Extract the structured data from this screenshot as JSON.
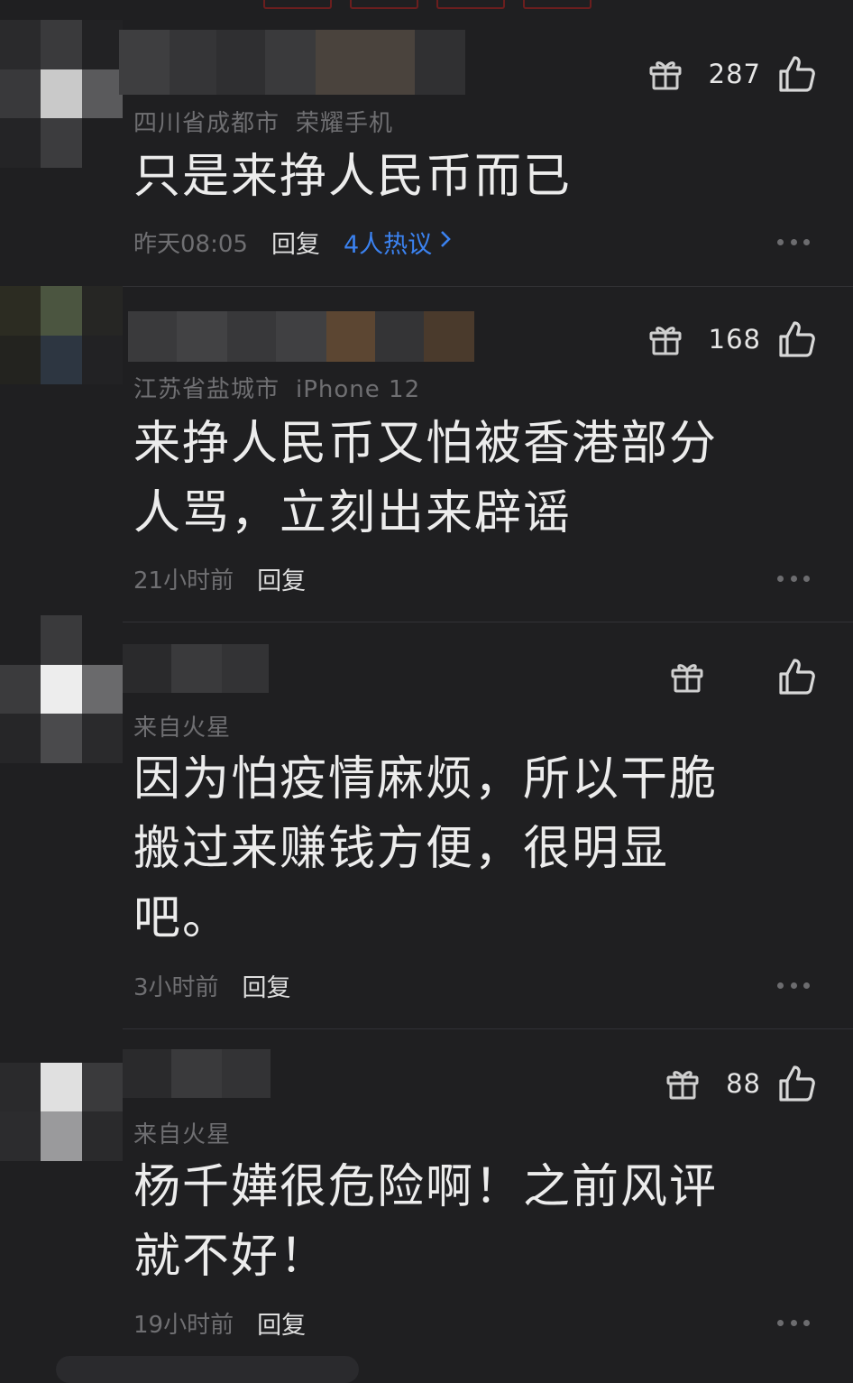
{
  "colors": {
    "background": "#1f1f21",
    "text_primary": "#ececec",
    "text_meta": "#6f6f72",
    "link_blue": "#3b82f0",
    "divider": "#323236"
  },
  "icons": {
    "gift": "gift-icon",
    "like": "thumbs-up-icon",
    "more": "more-dots-icon",
    "chevron": "chevron-right-icon"
  },
  "comments": [
    {
      "meta": [
        "四川省成都市",
        "荣耀手机"
      ],
      "content": [
        "只是来挣人民币而已"
      ],
      "time": "昨天08:05",
      "reply_label": "回复",
      "hot_label": "4人热议",
      "hot_chevron": "›",
      "likes": "287"
    },
    {
      "meta": [
        "江苏省盐城市",
        "iPhone 12"
      ],
      "content": [
        "来挣人民币又怕被香港部分",
        "人骂，立刻出来辟谣"
      ],
      "time": "21小时前",
      "reply_label": "回复",
      "likes": "168"
    },
    {
      "meta": [
        "来自火星"
      ],
      "content": [
        "因为怕疫情麻烦，所以干脆",
        "搬过来赚钱方便，很明显",
        "吧。"
      ],
      "time": "3小时前",
      "reply_label": "回复",
      "likes": ""
    },
    {
      "meta": [
        "来自火星"
      ],
      "content": [
        "杨千嬅很危险啊！之前风评",
        "就不好！"
      ],
      "time": "19小时前",
      "reply_label": "回复",
      "likes": "88"
    }
  ]
}
